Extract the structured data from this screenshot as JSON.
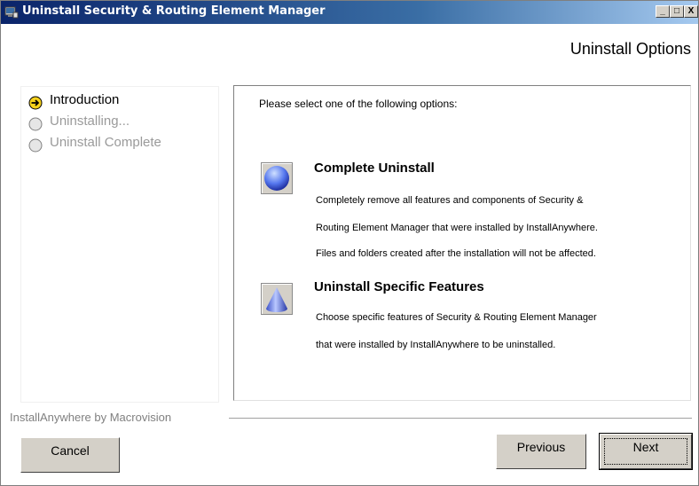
{
  "window": {
    "title": "Uninstall Security & Routing Element Manager",
    "controls": {
      "minimize": "_",
      "maximize": "□",
      "close": "X"
    }
  },
  "header": {
    "title": "Uninstall Options"
  },
  "steps": [
    {
      "label": "Introduction",
      "state": "current",
      "icon": "arrow-right-icon"
    },
    {
      "label": "Uninstalling...",
      "state": "pending",
      "icon": "circle-icon"
    },
    {
      "label": "Uninstall Complete",
      "state": "pending",
      "icon": "circle-icon"
    }
  ],
  "main": {
    "prompt": "Please select one of the following options:",
    "options": [
      {
        "title": "Complete Uninstall",
        "icon": "sphere-icon",
        "description": [
          "Completely remove all features and components of Security &",
          "Routing Element Manager that were installed by InstallAnywhere.",
          "Files and folders created after the installation will not be affected."
        ]
      },
      {
        "title": "Uninstall Specific Features",
        "icon": "cone-icon",
        "description": [
          "Choose specific features of Security & Routing Element Manager",
          "that were installed by InstallAnywhere to be uninstalled."
        ]
      }
    ]
  },
  "footer": {
    "brand": "InstallAnywhere by Macrovision",
    "cancel_label": "Cancel",
    "previous_label": "Previous",
    "next_label": "Next"
  }
}
